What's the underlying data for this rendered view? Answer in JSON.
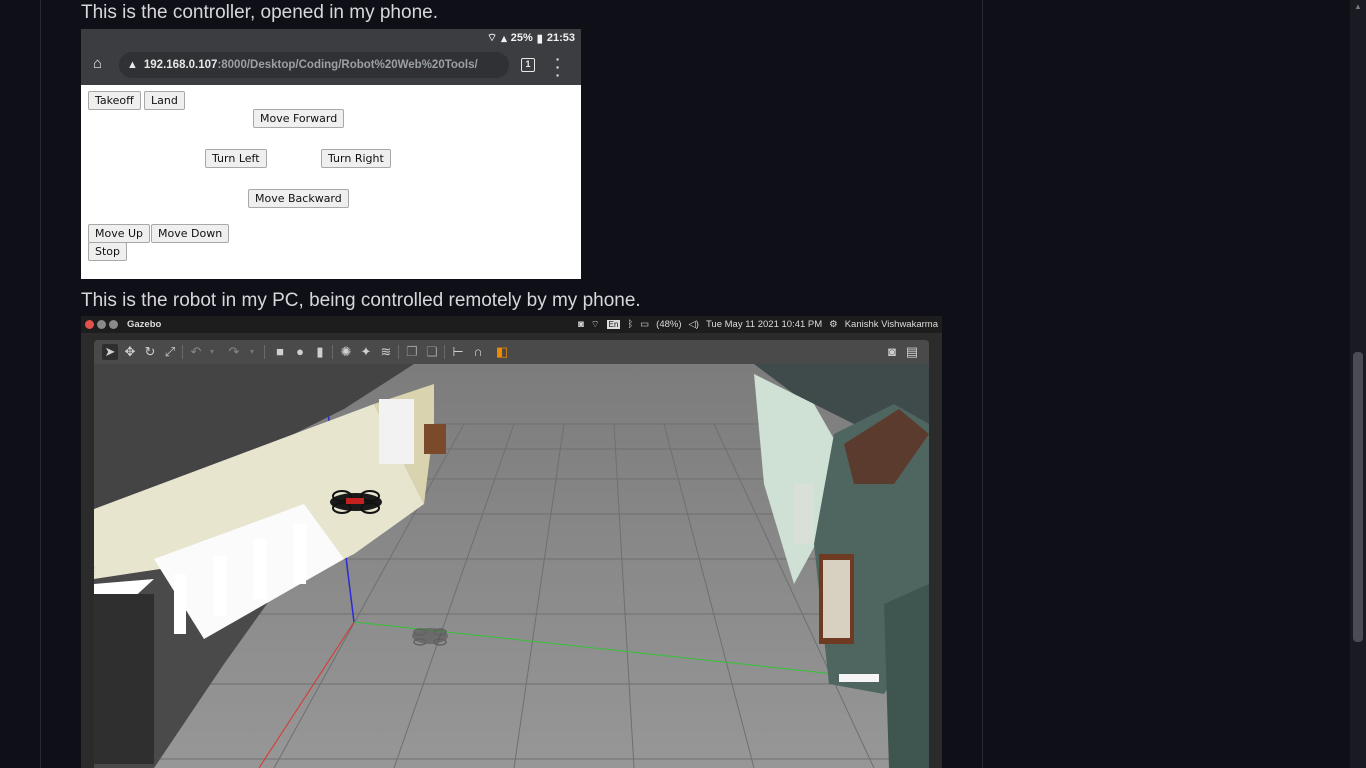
{
  "captions": {
    "controller": "This is the controller, opened in my phone.",
    "robot": "This is the robot in my PC, being controlled remotely by my phone."
  },
  "phone": {
    "status": {
      "battery": "25%",
      "time": "21:53"
    },
    "url": {
      "host": "192.168.0.107",
      "path": ":8000/Desktop/Coding/Robot%20Web%20Tools/",
      "tab_count": "1"
    },
    "buttons": {
      "takeoff": "Takeoff",
      "land": "Land",
      "move_forward": "Move Forward",
      "turn_left": "Turn Left",
      "turn_right": "Turn Right",
      "move_backward": "Move Backward",
      "move_up": "Move Up",
      "move_down": "Move Down",
      "stop": "Stop"
    }
  },
  "gazebo": {
    "app_name": "Gazebo",
    "tray": {
      "lang": "En",
      "battery": "(48%)",
      "datetime": "Tue May 11 2021 10:41 PM",
      "user": "Kanishk Vishwakarma"
    },
    "colors": {
      "close": "#e3514c",
      "minimize": "#8a8a8a",
      "maximize": "#8a8a8a",
      "ground": "#8c8c8c",
      "axis_z": "#2a2ad8",
      "axis_y": "#34c234",
      "axis_x": "#d33",
      "box_tool": "#f08a00"
    }
  }
}
